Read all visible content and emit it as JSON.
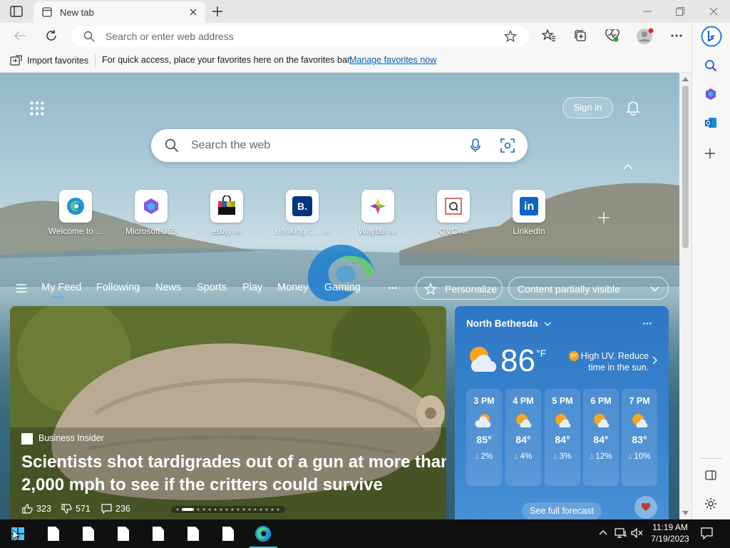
{
  "browser": {
    "tab_title": "New tab",
    "address_placeholder": "Search or enter web address",
    "favbar": {
      "import_label": "Import favorites",
      "quick_access_text": "For quick access, place your favorites here on the favorites bar.",
      "manage_link": "Manage favorites now"
    }
  },
  "newtab": {
    "sign_in": "Sign in",
    "search_placeholder": "Search the web",
    "quick_links": [
      {
        "label": "Welcome to ...",
        "ad": ""
      },
      {
        "label": "Microsoft 365",
        "ad": ""
      },
      {
        "label": "eBay",
        "ad": "Ad"
      },
      {
        "label": "Booking.c...",
        "ad": "Ad"
      },
      {
        "label": "Wayfair",
        "ad": "Ad"
      },
      {
        "label": "QVC",
        "ad": "Ad"
      },
      {
        "label": "LinkedIn",
        "ad": ""
      }
    ],
    "feed_nav": [
      "My Feed",
      "Following",
      "News",
      "Sports",
      "Play",
      "Money",
      "Gaming"
    ],
    "personalize": "Personalize",
    "content_visibility": "Content partially visible",
    "article": {
      "source": "Business Insider",
      "headline_line1": "Scientists shot tardigrades out of a gun at more than",
      "headline_line2": "2,000 mph to see if the critters could survive",
      "likes": "323",
      "dislikes": "571",
      "comments": "236"
    },
    "weather": {
      "location": "North Bethesda",
      "temp": "86",
      "unit": "°F",
      "uv_badge": "UV",
      "alert_line1": "High UV. Reduce",
      "alert_line2": "time in the sun.",
      "hours": [
        {
          "time": "3 PM",
          "temp": "85°",
          "precip": "2%"
        },
        {
          "time": "4 PM",
          "temp": "84°",
          "precip": "4%"
        },
        {
          "time": "5 PM",
          "temp": "84°",
          "precip": "3%"
        },
        {
          "time": "6 PM",
          "temp": "84°",
          "precip": "12%"
        },
        {
          "time": "7 PM",
          "temp": "83°",
          "precip": "10%"
        }
      ],
      "forecast_link": "See full forecast"
    }
  },
  "taskbar": {
    "time": "11:19 AM",
    "date": "7/19/2023"
  },
  "colors": {
    "edge_blue": "#0c59a4",
    "link_blue": "#0060b6",
    "taskbar": "#101010"
  }
}
